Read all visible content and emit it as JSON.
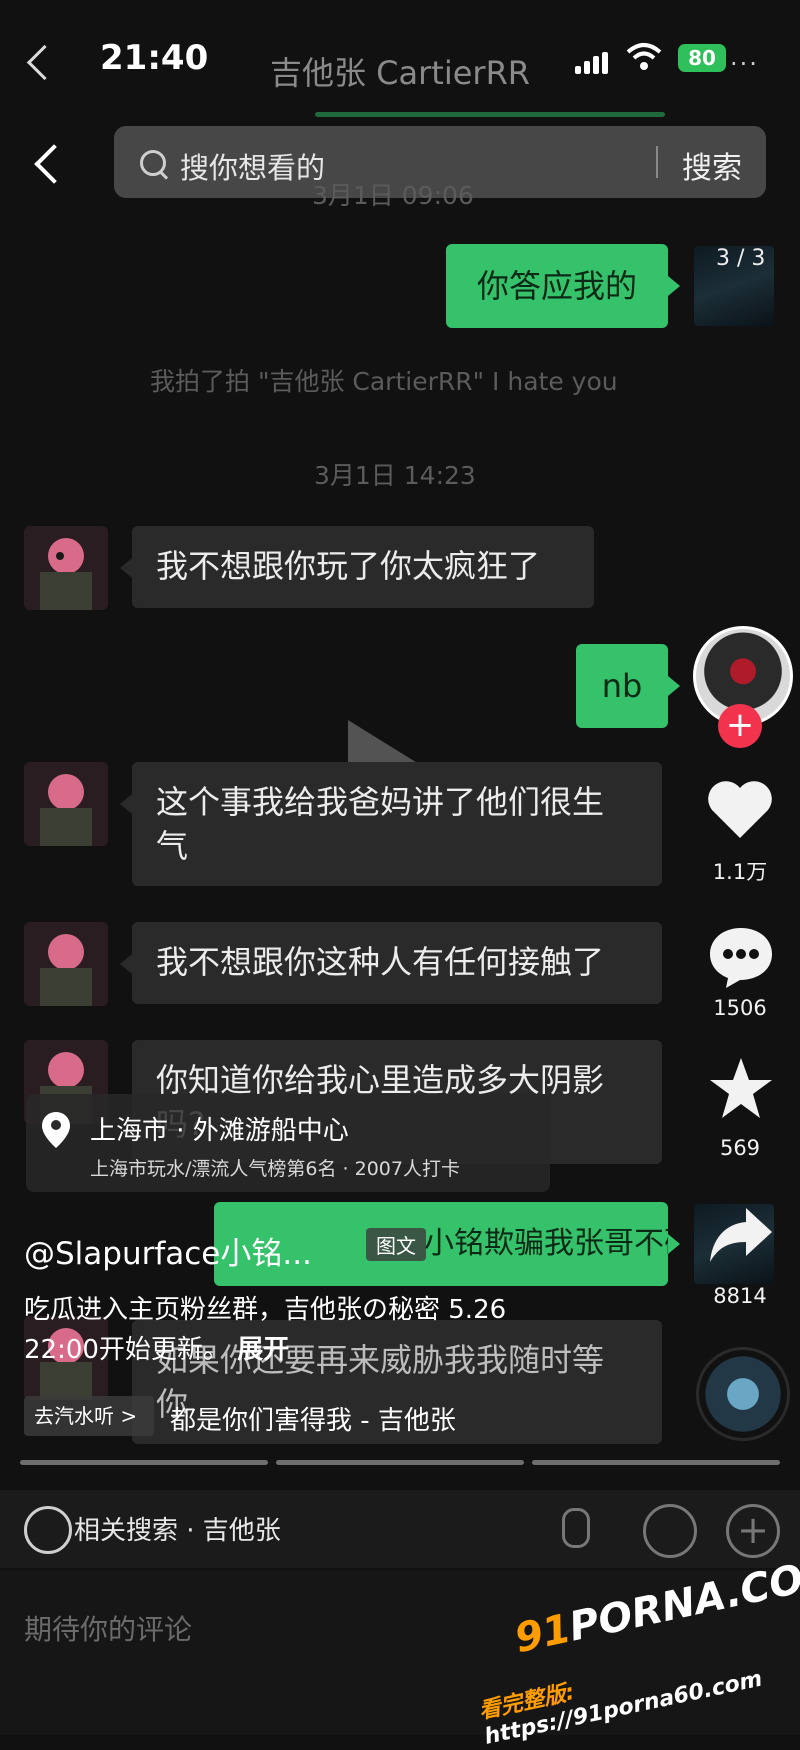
{
  "status_bar": {
    "time": "21:40",
    "battery": "80",
    "chat_title": "吉他张 CartierRR"
  },
  "search": {
    "placeholder": "搜你想看的",
    "button": "搜索"
  },
  "chat": {
    "timestamp_1": "3月1日 09:06",
    "timestamp_2": "3月1日 14:23",
    "system_pat": "我拍了拍 \"吉他张 CartierRR\" I hate you",
    "page_indicator": "3 / 3",
    "messages": [
      {
        "side": "out",
        "text": "你答应我的"
      },
      {
        "side": "in",
        "text": "我不想跟你玩了你太疯狂了"
      },
      {
        "side": "out",
        "text": "nb"
      },
      {
        "side": "in",
        "line1": "这个事我给我爸妈讲了他们很生",
        "line2": "气"
      },
      {
        "side": "in",
        "text": "我不想跟你这种人有任何接触了"
      },
      {
        "side": "in",
        "line1": "你知道你给我心里造成多大阴影",
        "line2": "吗?"
      },
      {
        "side": "out",
        "text": "小铭欺骗我张哥不确定?"
      },
      {
        "side": "in",
        "line1": "如果你还要再来威胁我我随时等",
        "line2": "你"
      }
    ]
  },
  "actions": {
    "likes": "1.1万",
    "comments": "1506",
    "favorites": "569",
    "shares": "8814",
    "follow_plus": "+"
  },
  "location": {
    "title": "上海市 · 外滩游船中心",
    "subtitle": "上海市玩水/漂流人气榜第6名 · 2007人打卡"
  },
  "post": {
    "author": "@Slapurface小铭...",
    "tag": "图文",
    "desc_line1": "吃瓜进入主页粉丝群，吉他张の秘密 5.26",
    "desc_line2": "22:00开始更新。",
    "expand": "展开"
  },
  "music": {
    "chip": "去汽水听 >",
    "song": "都是你们害得我 - 吉他张"
  },
  "bottom": {
    "related": "相关搜索 · 吉他张",
    "comment_placeholder": "期待你的评论"
  },
  "watermark": {
    "logo_prefix": "91",
    "logo_main": "PORNA.COM",
    "url_prefix": "看完整版: ",
    "url": "https://91porna60.com"
  }
}
